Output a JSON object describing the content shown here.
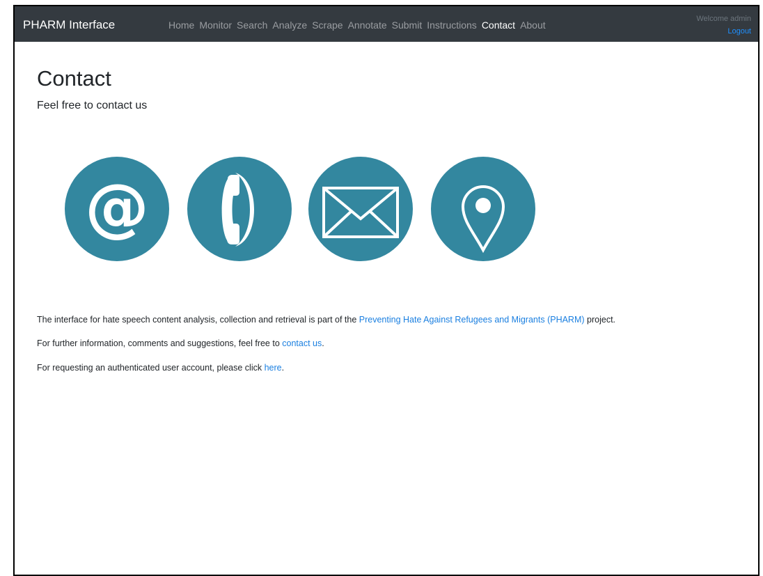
{
  "navbar": {
    "brand": "PHARM Interface",
    "items": [
      {
        "label": "Home",
        "active": false
      },
      {
        "label": "Monitor",
        "active": false
      },
      {
        "label": "Search",
        "active": false
      },
      {
        "label": "Analyze",
        "active": false
      },
      {
        "label": "Scrape",
        "active": false
      },
      {
        "label": "Annotate",
        "active": false
      },
      {
        "label": "Submit",
        "active": false
      },
      {
        "label": "Instructions",
        "active": false
      },
      {
        "label": "Contact",
        "active": true
      },
      {
        "label": "About",
        "active": false
      }
    ],
    "welcome": "Welcome admin",
    "logout": "Logout"
  },
  "page": {
    "title": "Contact",
    "subtitle": "Feel free to contact us"
  },
  "icons": {
    "color": "#33879f",
    "items": [
      "at-sign-icon",
      "phone-icon",
      "envelope-icon",
      "map-pin-icon"
    ]
  },
  "paragraphs": {
    "p1_before": "The interface for hate speech content analysis, collection and retrieval is part of the ",
    "p1_link": "Preventing Hate Against Refugees and Migrants (PHARM)",
    "p1_after": " project.",
    "p2_before": "For further information, comments and suggestions, feel free to ",
    "p2_link": "contact us",
    "p2_after": ".",
    "p3_before": "For requesting an authenticated user account, please click ",
    "p3_link": "here",
    "p3_after": "."
  },
  "colors": {
    "navbar_bg": "#343a40",
    "link": "#1a7fe0",
    "icon_circle": "#33879f"
  }
}
